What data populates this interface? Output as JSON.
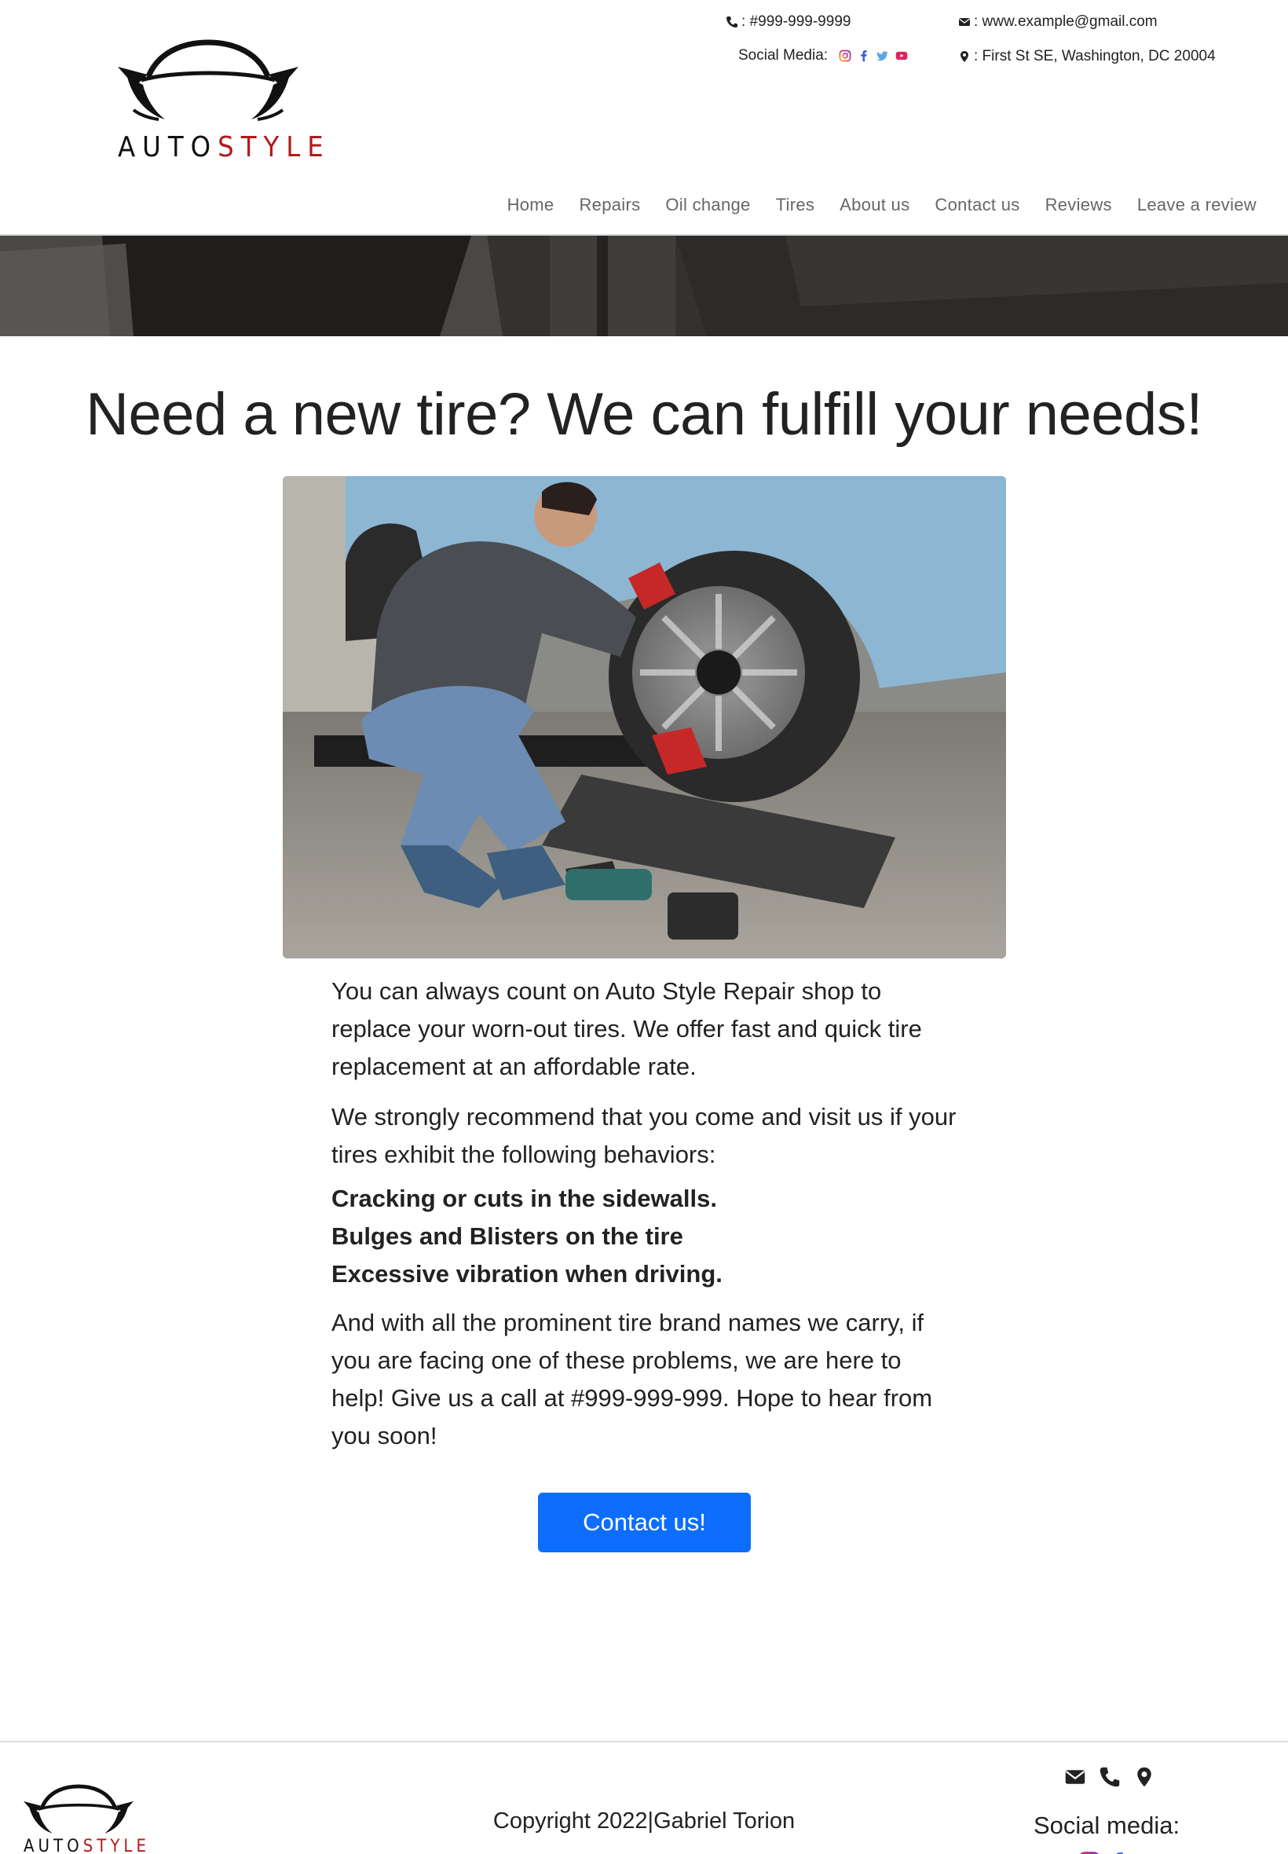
{
  "brand": {
    "logo_word_1": "AUTO",
    "logo_word_2": "STYLE",
    "accent_color": "#b01b1b"
  },
  "top_contact": {
    "phone": ": #999-999-9999",
    "email": ": www.example@gmail.com",
    "address": ": First St SE, Washington, DC 20004",
    "social_label": "Social Media:",
    "icons": [
      "phone-icon",
      "envelope-icon",
      "location-pin-icon",
      "instagram-icon",
      "facebook-icon",
      "twitter-icon",
      "youtube-icon"
    ]
  },
  "nav": {
    "items": [
      "Home",
      "Repairs",
      "Oil change",
      "Tires",
      "About us",
      "Contact us",
      "Reviews",
      "Leave a review"
    ]
  },
  "main": {
    "headline": "Need a new tire? We can fulfill your needs!",
    "paragraph_1": "You can always count on Auto Style Repair shop to replace your worn-out tires. We offer fast and quick tire replacement at an affordable rate.",
    "paragraph_2": "We strongly recommend that you come and visit us if your tires exhibit the following behaviors:",
    "symptoms": [
      "Cracking or cuts in the sidewalls.",
      "Bulges and Blisters on the tire",
      "Excessive vibration when driving."
    ],
    "paragraph_3": "And with all the prominent tire brand names we carry, if you are facing one of these problems, we are here to help! Give us a call at #999-999-999. Hope to hear from you soon!",
    "cta_label": "Contact us!",
    "cta_color": "#0d6efd"
  },
  "footer": {
    "copyright": "Copyright 2022|Gabriel Torion",
    "social_label": "Social media:",
    "icons": [
      "envelope-icon",
      "phone-icon",
      "location-pin-icon",
      "instagram-icon",
      "facebook-icon",
      "twitter-icon",
      "youtube-icon"
    ]
  }
}
